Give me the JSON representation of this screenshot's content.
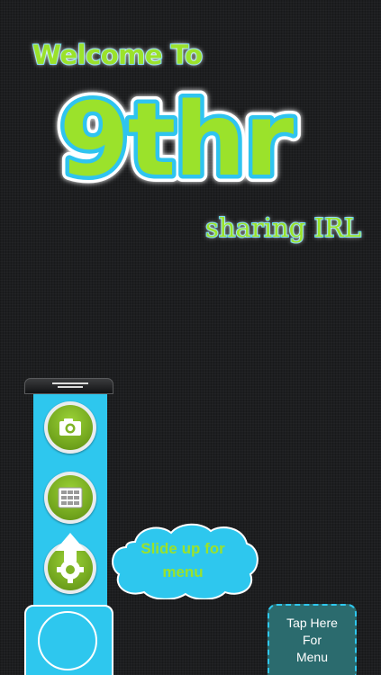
{
  "welcome": {
    "line": "Welcome To"
  },
  "logo": {
    "text": "9thr"
  },
  "tagline": {
    "text": "sharing IRL"
  },
  "menu": {
    "buttons": [
      {
        "icon": "camera-icon"
      },
      {
        "icon": "grid-icon"
      },
      {
        "icon": "gear-icon"
      }
    ]
  },
  "hint": {
    "text": "Slide up for\nmenu"
  },
  "tap_button": {
    "label": "Tap Here\nFor\nMenu"
  },
  "colors": {
    "accent_blue": "#2ec7ee",
    "accent_green": "#9be22b",
    "background": "#1d1e20"
  }
}
